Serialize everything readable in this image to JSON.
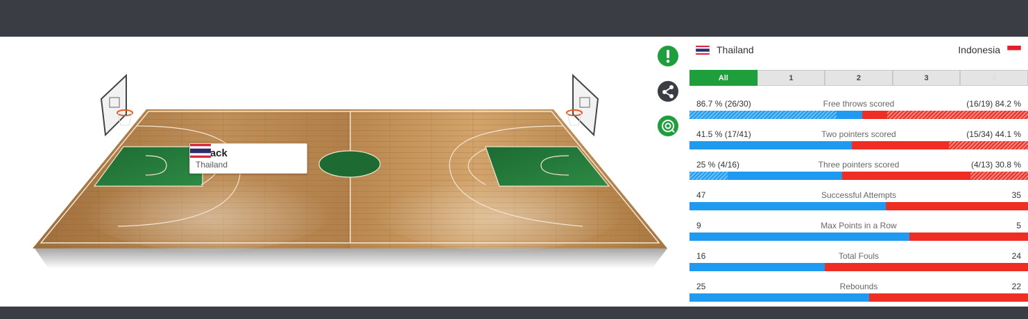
{
  "attack": {
    "title": "Attack",
    "team": "Thailand"
  },
  "teams": {
    "home": "Thailand",
    "away": "Indonesia"
  },
  "periods": [
    "All",
    "1",
    "2",
    "3",
    "4"
  ],
  "active_period": "All",
  "side_icons": [
    "alert-icon",
    "share-icon",
    "target-icon"
  ],
  "colors": {
    "home": "#1e9bf0",
    "away": "#ef2d22",
    "active_tab": "#1f9e3c",
    "bar_dark": "#3a3d44"
  },
  "stats": [
    {
      "label": "Free throws scored",
      "left": "86.7 % (26/30)",
      "right": "(16/19) 84.2 %",
      "home_share": 0.51
    },
    {
      "label": "Two pointers scored",
      "left": "41.5 % (17/41)",
      "right": "(15/34) 44.1 %",
      "home_share": 0.48
    },
    {
      "label": "Three pointers scored",
      "left": "25 % (4/16)",
      "right": "(4/13) 30.8 %",
      "home_share": 0.45
    },
    {
      "label": "Successful Attempts",
      "left": "47",
      "right": "35",
      "home_share": 0.58
    },
    {
      "label": "Max Points in a Row",
      "left": "9",
      "right": "5",
      "home_share": 0.65
    },
    {
      "label": "Total Fouls",
      "left": "16",
      "right": "24",
      "home_share": 0.4
    },
    {
      "label": "Rebounds",
      "left": "25",
      "right": "22",
      "home_share": 0.53
    }
  ]
}
